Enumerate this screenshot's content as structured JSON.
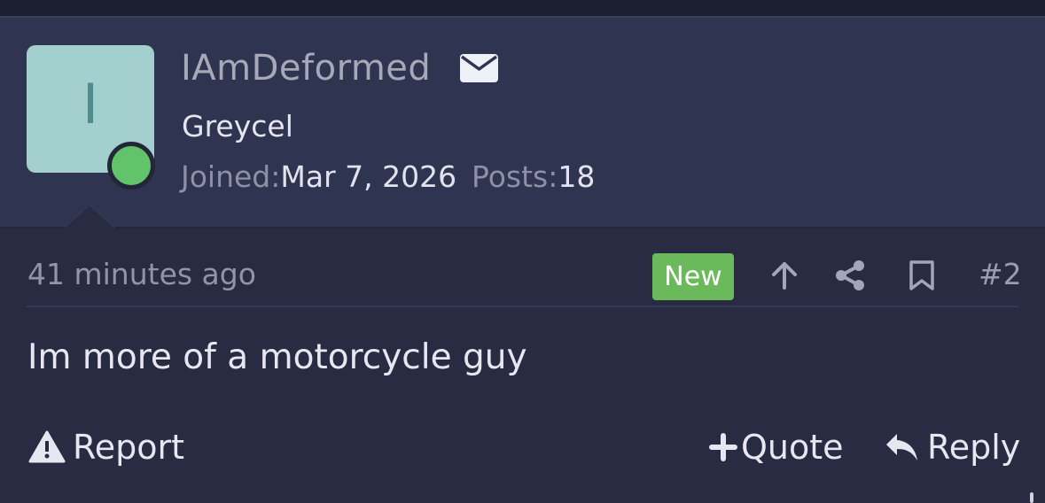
{
  "user": {
    "avatar_letter": "I",
    "username": "IAmDeformed",
    "rank": "Greycel",
    "joined_label": "Joined:",
    "joined_value": "Mar 7, 2026",
    "posts_label": "Posts:",
    "posts_value": "18"
  },
  "post": {
    "timestamp": "41 minutes ago",
    "new_badge": "New",
    "post_number": "#2",
    "body": "Im more of a motorcycle guy"
  },
  "actions": {
    "report": "Report",
    "quote": "Quote",
    "reply": "Reply"
  },
  "colors": {
    "background": "#282b41",
    "header": "#2f3450",
    "online": "#61c46b",
    "new_badge": "#6aba5c",
    "avatar": "#a3cfce"
  },
  "icons": [
    "envelope-icon",
    "upvote-arrow-icon",
    "share-icon",
    "bookmark-icon",
    "warning-icon",
    "plus-icon",
    "reply-icon"
  ]
}
